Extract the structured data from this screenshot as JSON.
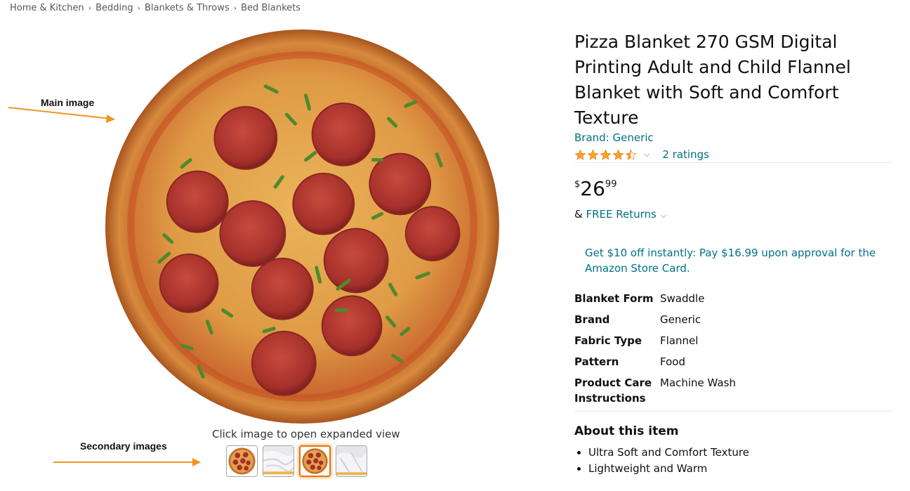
{
  "breadcrumb": {
    "items": [
      "Home & Kitchen",
      "Bedding",
      "Blankets & Throws",
      "Bed Blankets"
    ],
    "separator": "›"
  },
  "annotations": {
    "main_image": "Main image",
    "secondary_images": "Secondary images",
    "arrow_color": "#f0961e"
  },
  "gallery": {
    "zoom_hint": "Click image to open expanded view",
    "thumbnails": [
      "pizza",
      "white-blanket",
      "pizza",
      "white-blanket"
    ],
    "selected_index": 2
  },
  "product": {
    "title": "Pizza Blanket 270 GSM Digital Printing Adult and Child Flannel Blanket with Soft and Comfort Texture",
    "brand": "Brand: Generic",
    "rating_stars": 4.5,
    "ratings_count": "2 ratings",
    "price": {
      "symbol": "$",
      "whole": "26",
      "fraction": "99"
    },
    "returns_prefix": "&",
    "returns": "FREE Returns",
    "promo": "Get $10 off instantly: Pay $16.99 upon approval for the Amazon Store Card.",
    "specs": [
      {
        "label": "Blanket Form",
        "value": "Swaddle"
      },
      {
        "label": "Brand",
        "value": "Generic"
      },
      {
        "label": "Fabric Type",
        "value": "Flannel"
      },
      {
        "label": "Pattern",
        "value": "Food"
      },
      {
        "label": "Product Care Instructions",
        "value": "Machine Wash"
      }
    ],
    "about_heading": "About this item",
    "about_bullets": [
      "Ultra Soft and Comfort Texture",
      "Lightweight and Warm"
    ]
  },
  "colors": {
    "link": "#007185",
    "star": "#ffa41c",
    "thumb_selected": "#e77600"
  }
}
